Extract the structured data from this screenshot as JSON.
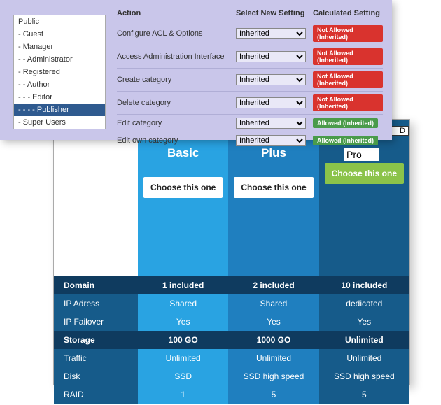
{
  "overlay": {
    "groups": [
      "Public",
      "- Guest",
      "- Manager",
      "- - Administrator",
      "- Registered",
      "- - Author",
      "- - - Editor",
      "- - - - Publisher",
      "- Super Users"
    ],
    "selected_index": 7,
    "headers": {
      "action": "Action",
      "setting": "Select New Setting",
      "calc": "Calculated Setting"
    },
    "select_value": "Inherited",
    "perms": [
      {
        "action": "Configure ACL & Options",
        "calc": "Not Allowed (Inherited)",
        "style": "red"
      },
      {
        "action": "Access Administration Interface",
        "calc": "Not Allowed (Inherited)",
        "style": "red"
      },
      {
        "action": "Create category",
        "calc": "Not Allowed (Inherited)",
        "style": "red"
      },
      {
        "action": "Delete category",
        "calc": "Not Allowed (Inherited)",
        "style": "red"
      },
      {
        "action": "Edit category",
        "calc": "Allowed (Inherited)",
        "style": "green"
      },
      {
        "action": "Edit own category",
        "calc": "Allowed (Inherited)",
        "style": "green"
      }
    ]
  },
  "float": {
    "d": "D",
    "pro": "Pro"
  },
  "pricing": {
    "plans": {
      "basic": {
        "name": "Basic",
        "choose": "Choose this one"
      },
      "plus": {
        "name": "Plus",
        "choose": "Choose this one"
      },
      "pro": {
        "name": "",
        "choose": "Choose this one"
      }
    },
    "sections": {
      "domain": {
        "label": "Domain",
        "basic_b": "1",
        "basic_t": " included",
        "plus_b": "2",
        "plus_t": " included",
        "pro_b": "10",
        "pro_t": " included"
      },
      "storage": {
        "label": "Storage",
        "basic_b": "100 ",
        "basic_t": "GO",
        "plus_b": "1000 ",
        "plus_t": "GO",
        "pro_b": "Unlimited",
        "pro_t": ""
      }
    },
    "rows": {
      "ip": {
        "label": "IP Adress",
        "basic": "Shared",
        "plus": "Shared",
        "pro": "dedicated"
      },
      "failover": {
        "label": "IP Failover",
        "basic": "Yes",
        "plus": "Yes",
        "pro": "Yes"
      },
      "traffic": {
        "label": "Traffic",
        "basic": "Unlimited",
        "plus": "Unlimited",
        "pro": "Unlimited"
      },
      "disk": {
        "label": "Disk",
        "basic": "SSD",
        "plus": "SSD high speed",
        "pro": "SSD high speed"
      },
      "raid": {
        "label": "RAID",
        "basic": "1",
        "plus": "5",
        "pro": "5"
      }
    }
  }
}
